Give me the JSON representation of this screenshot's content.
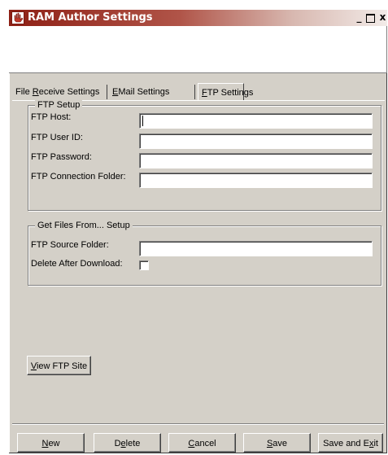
{
  "window": {
    "title": "RAM Author Settings",
    "minimize_glyph": "_",
    "close_glyph": "x"
  },
  "tabs": [
    {
      "pre": "File ",
      "key": "R",
      "post": "eceive Settings"
    },
    {
      "pre": "",
      "key": "E",
      "post": "Mail Settings"
    },
    {
      "pre": "",
      "key": "F",
      "post": "TP Settings"
    }
  ],
  "ftp_setup": {
    "title": "FTP Setup",
    "host_label": "FTP Host:",
    "host_value": "",
    "user_label": "FTP User ID:",
    "user_value": "",
    "password_label": "FTP Password:",
    "password_value": "",
    "folder_label": "FTP Connection Folder:",
    "folder_value": ""
  },
  "get_files": {
    "title": "Get Files From... Setup",
    "source_label": "FTP Source Folder:",
    "source_value": "",
    "delete_label": "Delete After Download:",
    "delete_checked": false
  },
  "view_button": {
    "key": "V",
    "post": "iew FTP Site"
  },
  "buttons": {
    "new": {
      "key": "N",
      "post": "ew"
    },
    "delete": {
      "pre": "D",
      "key": "e",
      "post": "lete"
    },
    "cancel": {
      "key": "C",
      "post": "ancel"
    },
    "save": {
      "key": "S",
      "post": "ave"
    },
    "save_exit": {
      "pre": "Save and E",
      "key": "x",
      "post": "it"
    }
  },
  "colors": {
    "title_start": "#8e2015",
    "title_end": "#f2ebe8",
    "face": "#d4d0c8"
  },
  "icons": {
    "app": "red-hand-icon"
  }
}
